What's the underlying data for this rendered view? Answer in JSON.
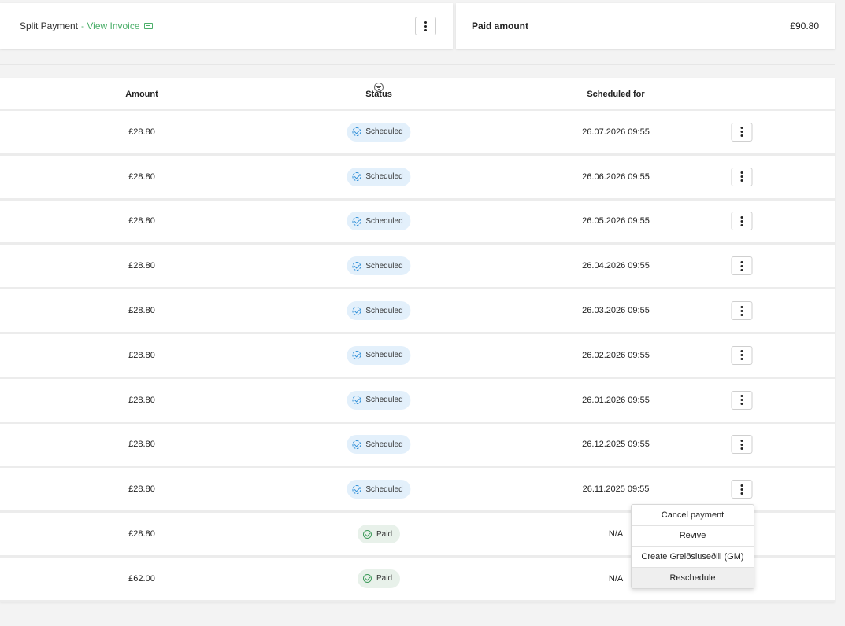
{
  "top": {
    "split_label": "Split Payment",
    "view_invoice": "- View Invoice",
    "paid_label": "Paid amount",
    "paid_value": "£90.80"
  },
  "table": {
    "headers": {
      "amount": "Amount",
      "status": "Status",
      "scheduled_for": "Scheduled for"
    },
    "rows": [
      {
        "amount": "£28.80",
        "status": "Scheduled",
        "status_type": "scheduled",
        "date": "26.07.2026 09:55"
      },
      {
        "amount": "£28.80",
        "status": "Scheduled",
        "status_type": "scheduled",
        "date": "26.06.2026 09:55"
      },
      {
        "amount": "£28.80",
        "status": "Scheduled",
        "status_type": "scheduled",
        "date": "26.05.2026 09:55"
      },
      {
        "amount": "£28.80",
        "status": "Scheduled",
        "status_type": "scheduled",
        "date": "26.04.2026 09:55"
      },
      {
        "amount": "£28.80",
        "status": "Scheduled",
        "status_type": "scheduled",
        "date": "26.03.2026 09:55"
      },
      {
        "amount": "£28.80",
        "status": "Scheduled",
        "status_type": "scheduled",
        "date": "26.02.2026 09:55"
      },
      {
        "amount": "£28.80",
        "status": "Scheduled",
        "status_type": "scheduled",
        "date": "26.01.2026 09:55"
      },
      {
        "amount": "£28.80",
        "status": "Scheduled",
        "status_type": "scheduled",
        "date": "26.12.2025 09:55"
      },
      {
        "amount": "£28.80",
        "status": "Scheduled",
        "status_type": "scheduled",
        "date": "26.11.2025 09:55"
      },
      {
        "amount": "£28.80",
        "status": "Paid",
        "status_type": "paid",
        "date": "N/A"
      },
      {
        "amount": "£62.00",
        "status": "Paid",
        "status_type": "paid",
        "date": "N/A"
      }
    ]
  },
  "menu": {
    "items": [
      "Cancel payment",
      "Revive",
      "Create Greiðsluseðill (GM)",
      "Reschedule"
    ],
    "hovered": "Reschedule"
  },
  "colors": {
    "accent_green": "#4caf6a",
    "scheduled_badge": "#e3f0fb",
    "paid_badge": "#e8f1ea"
  }
}
